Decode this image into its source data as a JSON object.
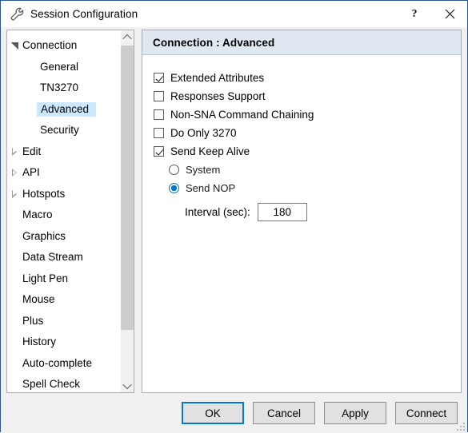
{
  "window": {
    "title": "Session Configuration",
    "icon": "wrench-icon",
    "help_label": "?",
    "close_label": "✕",
    "accent_color": "#0078d7",
    "title_border_color": "#2b579a"
  },
  "sidebar": {
    "items": [
      {
        "label": "Connection",
        "level": 0,
        "state": "expanded",
        "selected": false
      },
      {
        "label": "General",
        "level": 1,
        "state": "leaf",
        "selected": false
      },
      {
        "label": "TN3270",
        "level": 1,
        "state": "leaf",
        "selected": false
      },
      {
        "label": "Advanced",
        "level": 1,
        "state": "leaf",
        "selected": true
      },
      {
        "label": "Security",
        "level": 1,
        "state": "leaf",
        "selected": false
      },
      {
        "label": "Edit",
        "level": 0,
        "state": "collapsed",
        "selected": false
      },
      {
        "label": "API",
        "level": 0,
        "state": "collapsed",
        "selected": false
      },
      {
        "label": "Hotspots",
        "level": 0,
        "state": "collapsed",
        "selected": false
      },
      {
        "label": "Macro",
        "level": 0,
        "state": "leaf",
        "selected": false
      },
      {
        "label": "Graphics",
        "level": 0,
        "state": "leaf",
        "selected": false
      },
      {
        "label": "Data Stream",
        "level": 0,
        "state": "leaf",
        "selected": false
      },
      {
        "label": "Light Pen",
        "level": 0,
        "state": "leaf",
        "selected": false
      },
      {
        "label": "Mouse",
        "level": 0,
        "state": "leaf",
        "selected": false
      },
      {
        "label": "Plus",
        "level": 0,
        "state": "leaf",
        "selected": false
      },
      {
        "label": "History",
        "level": 0,
        "state": "leaf",
        "selected": false
      },
      {
        "label": "Auto-complete",
        "level": 0,
        "state": "leaf",
        "selected": false
      },
      {
        "label": "Spell Check",
        "level": 0,
        "state": "leaf",
        "selected": false
      }
    ],
    "selection_color": "#cce8ff",
    "scrollbar": {
      "up_icon": "chevron-up-icon",
      "down_icon": "chevron-down-icon",
      "thumb_percent": 85
    }
  },
  "content": {
    "header": "Connection : Advanced",
    "checkboxes": [
      {
        "label": "Extended Attributes",
        "checked": true
      },
      {
        "label": "Responses Support",
        "checked": false
      },
      {
        "label": "Non-SNA Command Chaining",
        "checked": false
      },
      {
        "label": "Do Only 3270",
        "checked": false
      },
      {
        "label": "Send Keep Alive",
        "checked": true
      }
    ],
    "radios": [
      {
        "label": "System",
        "checked": false
      },
      {
        "label": "Send NOP",
        "checked": true
      }
    ],
    "interval": {
      "label": "Interval (sec):",
      "value": "180",
      "placeholder": ""
    }
  },
  "footer": {
    "buttons": [
      {
        "label": "OK",
        "default": true
      },
      {
        "label": "Cancel",
        "default": false
      },
      {
        "label": "Apply",
        "default": false
      },
      {
        "label": "Connect",
        "default": false
      }
    ],
    "resize_grip": "resize-grip-icon"
  }
}
